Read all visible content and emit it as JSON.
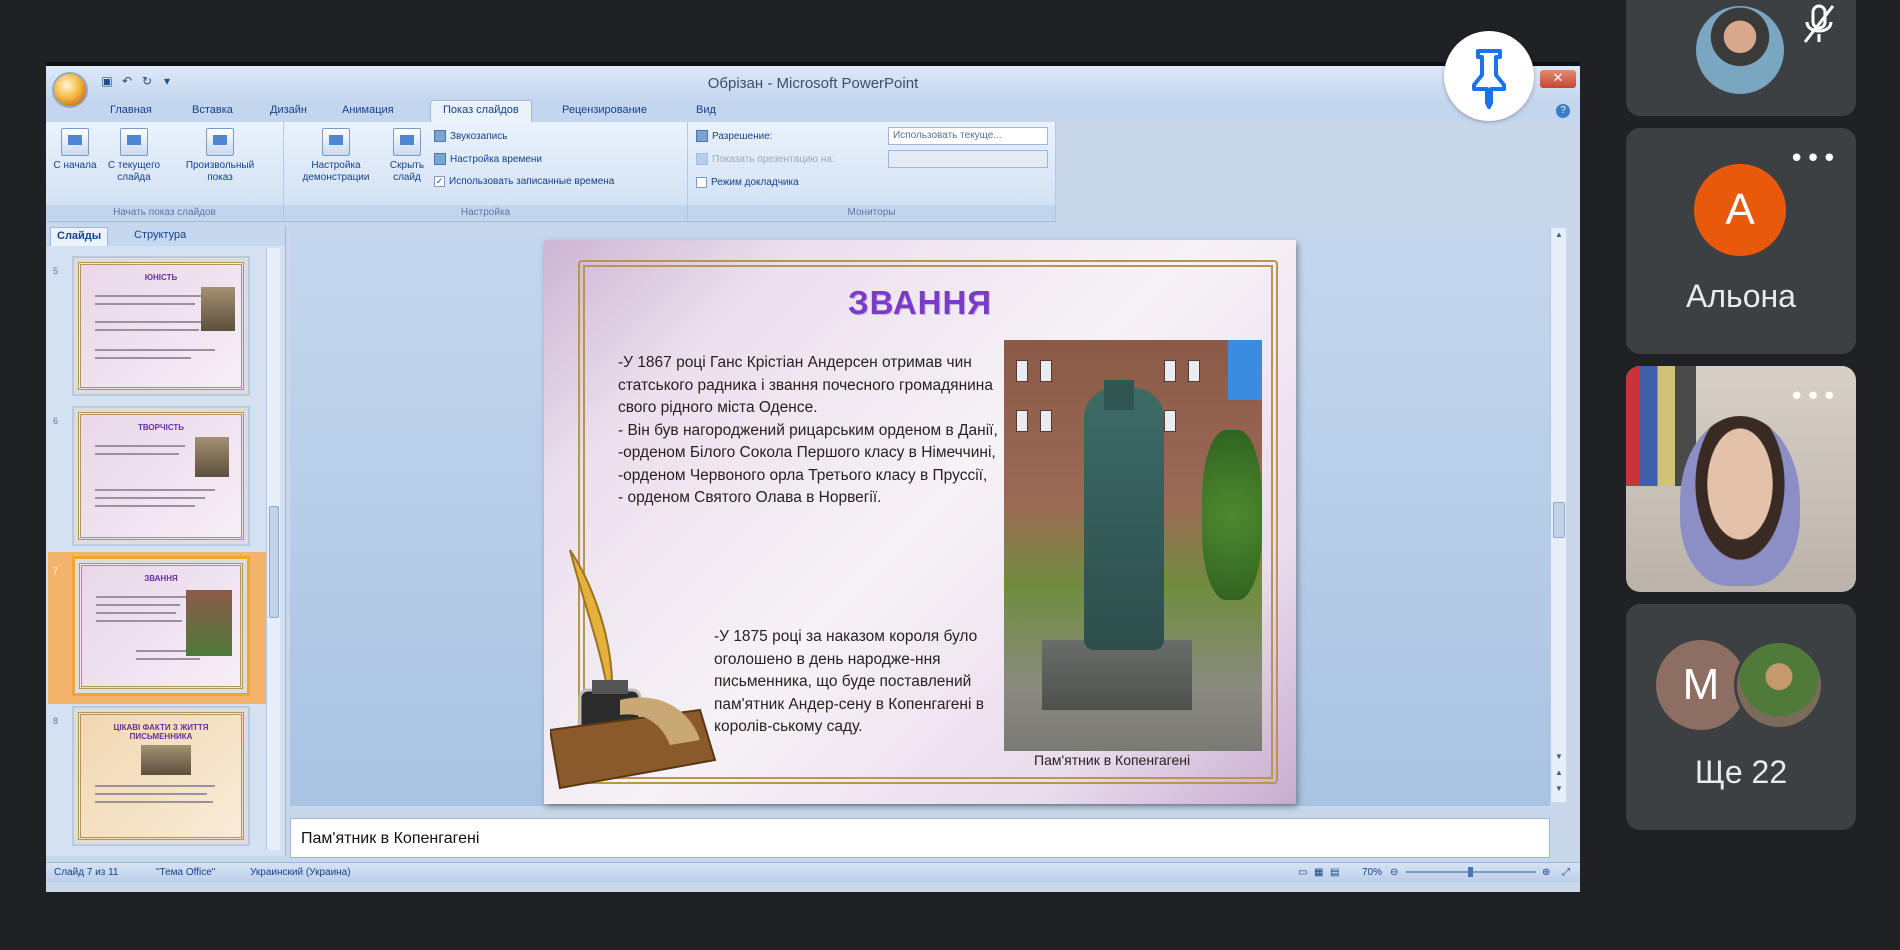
{
  "powerpoint": {
    "window_title": "Обрізан - Microsoft PowerPoint",
    "close_glyph": "✕",
    "tabs": [
      "Главная",
      "Вставка",
      "Дизайн",
      "Анимация",
      "Показ слайдов",
      "Рецензирование",
      "Вид"
    ],
    "active_tab": "Показ слайдов",
    "ribbon": {
      "start_group": {
        "label": "Начать показ слайдов",
        "from_start": "С начала",
        "from_current": "С текущего слайда",
        "custom": "Произвольный показ"
      },
      "setup_group": {
        "label": "Настройка",
        "setup_show": "Настройка демонстрации",
        "hide_slide": "Скрыть слайд",
        "record_narration": "Звукозапись",
        "rehearse_timings": "Настройка времени",
        "use_timings": "Использовать записанные времена"
      },
      "monitors_group": {
        "label": "Мониторы",
        "resolution_label": "Разрешение:",
        "resolution_value": "Использовать текуще...",
        "show_on_label": "Показать презентацию на:",
        "presenter_view": "Режим докладчика"
      }
    },
    "slides_pane": {
      "tab_slides": "Слайды",
      "tab_outline": "Структура",
      "thumbnails": [
        {
          "num": "5",
          "title": "ЮНІСТЬ"
        },
        {
          "num": "6",
          "title": "ТВОРЧІСТЬ"
        },
        {
          "num": "7",
          "title": "ЗВАННЯ"
        },
        {
          "num": "8",
          "title": "ЦІКАВІ ФАКТИ З ЖИТТЯ ПИСЬМЕННИКА"
        }
      ]
    },
    "slide": {
      "title": "ЗВАННЯ",
      "paragraph1": "-У 1867 році Ганс Крістіан Андерсен отримав чин статського радника і звання почесного громадянина свого рідного міста Оденсе.\n- Він був  нагороджений рицарським орденом в Данії,\n-орденом Білого Сокола Першого класу в Німеччині,\n-орденом Червоного орла Третього класу в Пруссії,\n- орденом Святого Олава в Норвегії.",
      "paragraph2": "-У 1875 році за наказом короля було оголошено в день народже-ння письменника, що буде поставлений пам'ятник Андер-сену в Копенгагені в королів-ському саду.",
      "photo_caption": "Пам'ятник в Копенгагені"
    },
    "notes": "Пам'ятник в Копенгагені",
    "status": {
      "slide_counter": "Слайд 7 из 11",
      "theme": "\"Тема Office\"",
      "language": "Украинский (Украина)",
      "zoom": "70%"
    }
  },
  "participants": [
    {
      "name": "",
      "kind": "video",
      "muted": true
    },
    {
      "name": "Альона",
      "initial": "А",
      "color": "#e8590c"
    },
    {
      "name": "",
      "kind": "video"
    },
    {
      "initial": "М",
      "color": "#8d6e63",
      "more_label": "Ще 22"
    }
  ],
  "icons": {
    "pin": "pin-icon",
    "mic_off": "mic-off-icon",
    "more": "more-options-icon"
  }
}
